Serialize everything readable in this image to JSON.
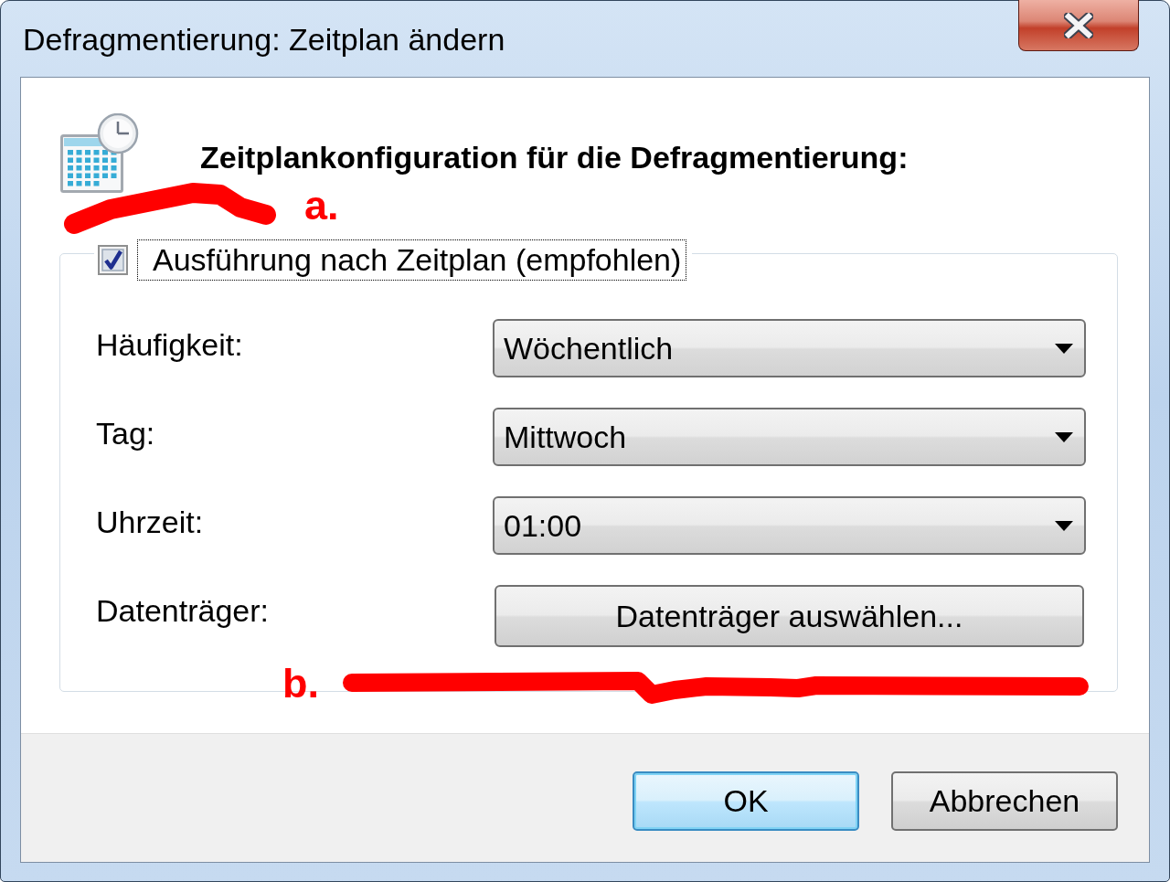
{
  "window": {
    "title": "Defragmentierung: Zeitplan ändern"
  },
  "header": {
    "heading": "Zeitplankonfiguration für die Defragmentierung:"
  },
  "schedule": {
    "checkbox": {
      "label": "Ausführung nach Zeitplan (empfohlen)",
      "checked": true,
      "focused": true
    },
    "fields": [
      {
        "kind": "dropdown",
        "label": "Häufigkeit:",
        "value": "Wöchentlich"
      },
      {
        "kind": "dropdown",
        "label": "Tag:",
        "value": "Mittwoch"
      },
      {
        "kind": "dropdown",
        "label": "Uhrzeit:",
        "value": "01:00"
      },
      {
        "kind": "button",
        "label": "Datenträger:",
        "button_label": "Datenträger auswählen..."
      }
    ]
  },
  "buttons": [
    {
      "label": "OK",
      "default": true
    },
    {
      "label": "Abbrechen",
      "default": false
    }
  ],
  "annotations": [
    {
      "label": "a."
    },
    {
      "label": "b."
    }
  ]
}
